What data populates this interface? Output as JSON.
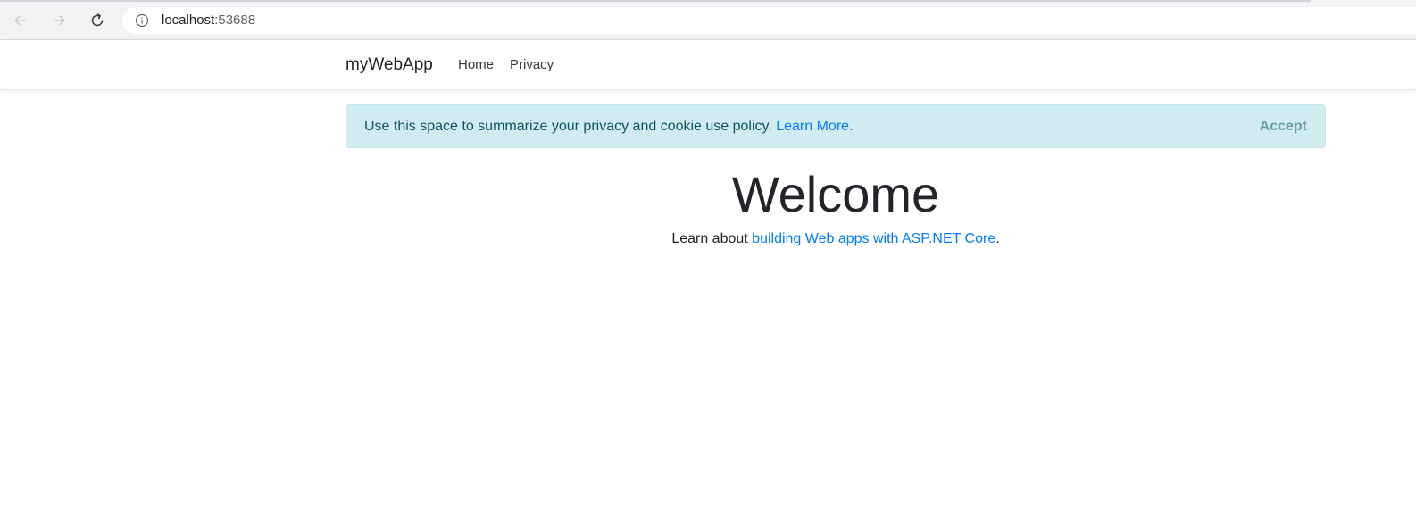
{
  "browser": {
    "url_host": "localhost",
    "url_port": ":53688"
  },
  "header": {
    "brand": "myWebApp",
    "nav": [
      {
        "label": "Home"
      },
      {
        "label": "Privacy"
      }
    ]
  },
  "cookie_consent": {
    "message": "Use this space to summarize your privacy and cookie use policy. ",
    "link_label": "Learn More",
    "trailing": ".",
    "accept_label": "Accept"
  },
  "main": {
    "title": "Welcome",
    "intro_prefix": "Learn about ",
    "intro_link": "building Web apps with ASP.NET Core",
    "intro_suffix": "."
  },
  "colors": {
    "link": "#007bff",
    "alert_bg": "#d1ecf1",
    "alert_text": "#0c5460"
  }
}
